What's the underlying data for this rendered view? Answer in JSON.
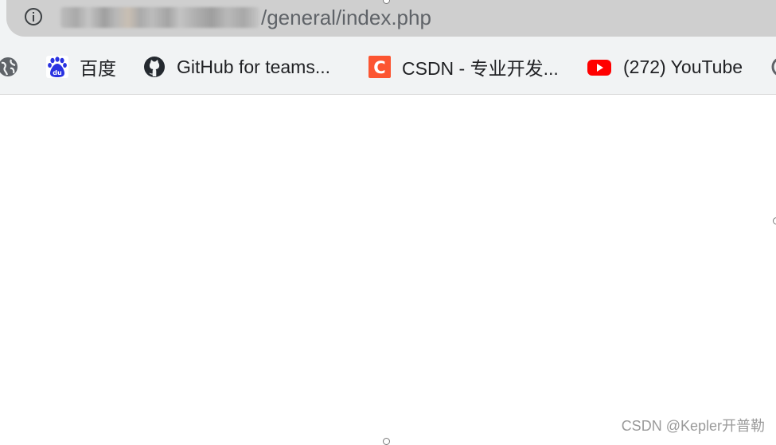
{
  "address_bar": {
    "url_path": "/general/index.php",
    "info_icon": "info-icon"
  },
  "bookmarks": [
    {
      "label": "",
      "icon": "globe-icon"
    },
    {
      "label": "百度",
      "icon": "baidu-icon"
    },
    {
      "label": "GitHub for teams...",
      "icon": "github-icon"
    },
    {
      "label": "CSDN - 专业开发...",
      "icon": "csdn-icon"
    },
    {
      "label": "(272) YouTube",
      "icon": "youtube-icon"
    }
  ],
  "watermark": "CSDN @Kepler开普勒",
  "colors": {
    "baidu_blue": "#2932e1",
    "csdn_red": "#fc5531",
    "youtube_red": "#ff0000"
  }
}
